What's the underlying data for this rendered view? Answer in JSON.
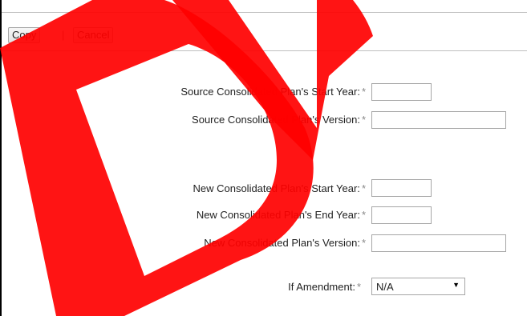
{
  "toolbar": {
    "copy_label": "Copy",
    "separator": "|",
    "cancel_label": "Cancel"
  },
  "form": {
    "required_marker": "*",
    "source_start_year": {
      "label": "Source Consolidated Plan's Start Year:",
      "value": ""
    },
    "source_version": {
      "label": "Source Consolidated Plan's Version:",
      "value": ""
    },
    "new_start_year": {
      "label": "New Consolidated Plan's Start Year:",
      "value": ""
    },
    "new_end_year": {
      "label": "New Consolidated Plan's End Year:",
      "value": ""
    },
    "new_version": {
      "label": "New Consolidated Plan's Version:",
      "value": ""
    },
    "amendment": {
      "label": "If Amendment:",
      "selected": "N/A"
    }
  },
  "watermark": {
    "text": "DV",
    "color": "#ff0000"
  }
}
